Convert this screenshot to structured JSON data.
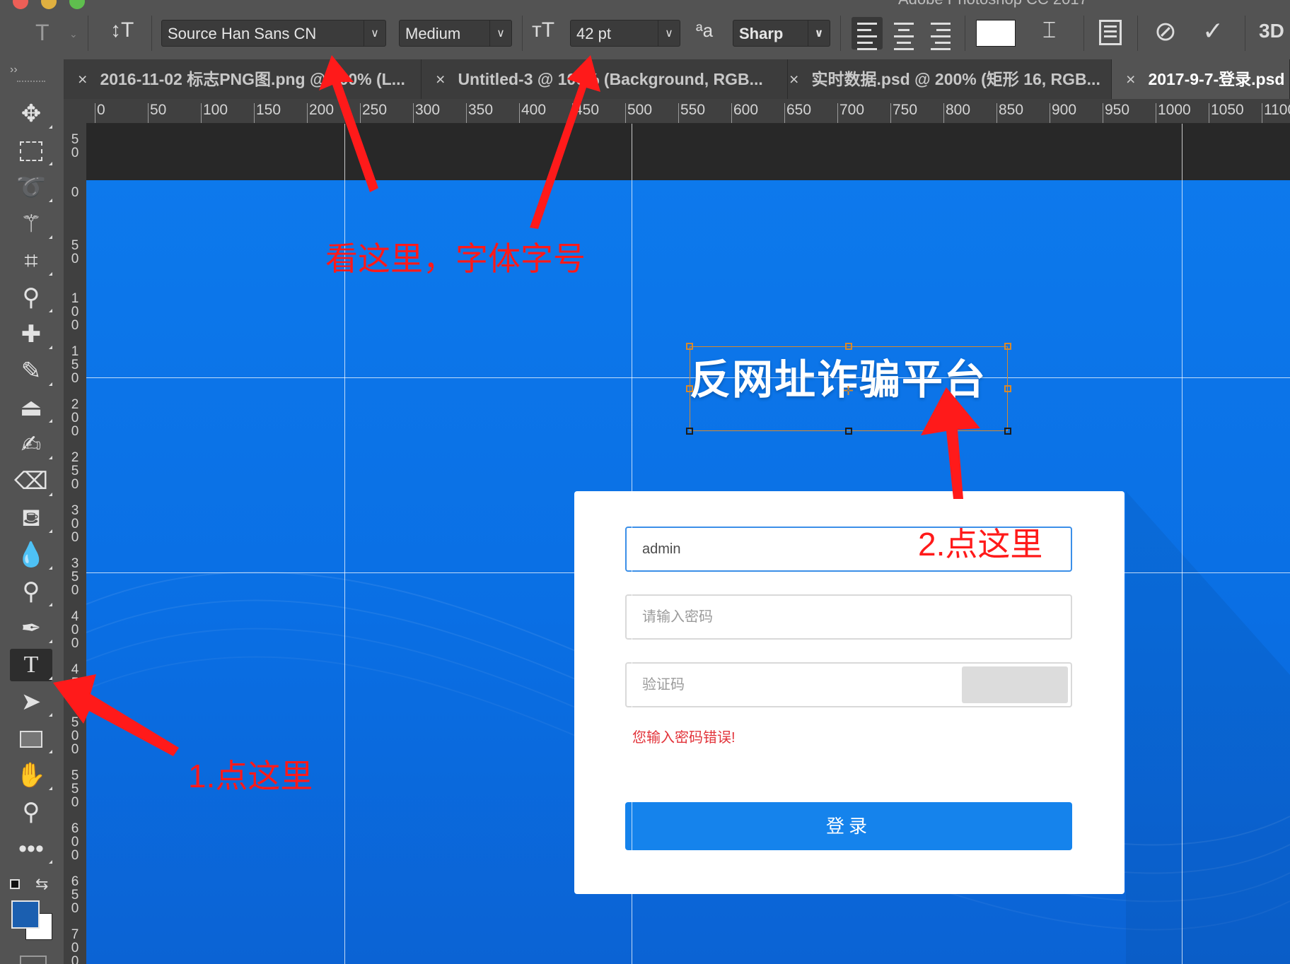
{
  "window": {
    "title_partial": "Adobe Photoshop CC 2017"
  },
  "options_bar": {
    "font_family": "Source Han Sans CN",
    "font_style": "Medium",
    "font_size": "42 pt",
    "antialias_icon_text": "ªa",
    "antialias": "Sharp",
    "three_d_label": "3D"
  },
  "tabs": [
    {
      "label": "2016-11-02 标志PNG图.png @ 100% (L..."
    },
    {
      "label": "Untitled-3 @ 100% (Background, RGB..."
    },
    {
      "label": "实时数据.psd @ 200% (矩形 16, RGB..."
    },
    {
      "label": "2017-9-7-登录.psd"
    }
  ],
  "ruler_top": [
    "0",
    "50",
    "100",
    "150",
    "200",
    "250",
    "300",
    "350",
    "400",
    "450",
    "500",
    "550",
    "600",
    "650",
    "700",
    "750",
    "800",
    "850",
    "900",
    "950",
    "1000",
    "1050",
    "1100"
  ],
  "ruler_left": [
    "50",
    "0",
    "50",
    "100",
    "150",
    "200",
    "250",
    "300",
    "350",
    "400",
    "450",
    "500",
    "550",
    "600",
    "650",
    "700"
  ],
  "canvas": {
    "heading": "反网址诈骗平台",
    "login": {
      "username_value": "admin",
      "password_placeholder": "请输入密码",
      "captcha_placeholder": "验证码",
      "error_message": "您输入密码错误!",
      "login_button": "登录"
    }
  },
  "annotations": {
    "top_note": "看这里，字体字号",
    "step1": "1.点这里",
    "step2": "2.点这里"
  },
  "colors": {
    "annotation_red": "#ff1a1a",
    "artboard_blue": "#0d79ec",
    "login_button_blue": "#1583ec",
    "error_red": "#e2333a",
    "foreground_swatch": "#1b5fb0"
  },
  "toolbar_tools": [
    "move",
    "marquee",
    "lasso",
    "magic-wand",
    "crop",
    "eyedropper",
    "healing",
    "brush",
    "clone-stamp",
    "history-brush",
    "eraser",
    "paint-bucket",
    "blur",
    "dodge",
    "pen",
    "type",
    "path-selection",
    "rectangle",
    "hand",
    "zoom",
    "more"
  ]
}
